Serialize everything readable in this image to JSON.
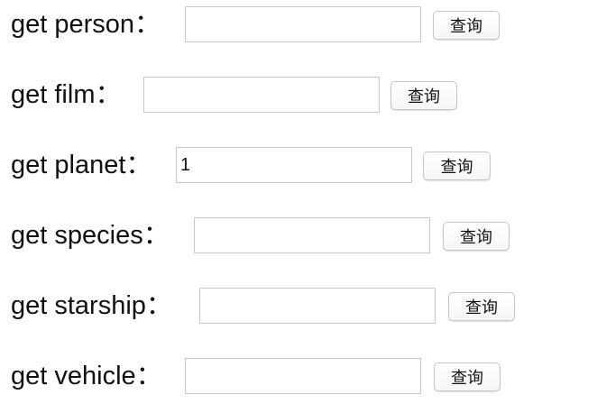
{
  "rows": [
    {
      "label": "get person：",
      "value": "",
      "button": "查询"
    },
    {
      "label": "get film：",
      "value": "",
      "button": "查询"
    },
    {
      "label": "get planet：",
      "value": "1",
      "button": "查询"
    },
    {
      "label": "get species：",
      "value": "",
      "button": "查询"
    },
    {
      "label": "get starship：",
      "value": "",
      "button": "查询"
    },
    {
      "label": "get vehicle：",
      "value": "",
      "button": "查询"
    }
  ]
}
